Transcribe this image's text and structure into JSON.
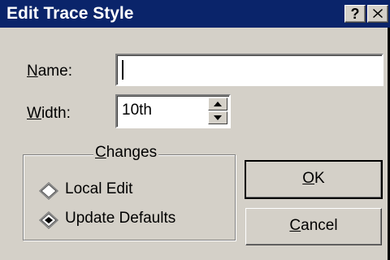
{
  "window": {
    "title": "Edit Trace Style",
    "help_button": "?",
    "title_color": "#0a246a"
  },
  "fields": {
    "name_label": "Name:",
    "name_value": "",
    "width_label": "Width:",
    "width_value": "10th"
  },
  "changes": {
    "caption": "Changes",
    "options": [
      {
        "label": "Local Edit",
        "selected": false
      },
      {
        "label": "Update Defaults",
        "selected": true
      }
    ]
  },
  "buttons": {
    "ok": "OK",
    "cancel": "Cancel"
  },
  "icons": {
    "close": "close-icon",
    "spin_up": "triangle-up-icon",
    "spin_down": "triangle-down-icon",
    "radio": "diamond-radio-icon"
  }
}
